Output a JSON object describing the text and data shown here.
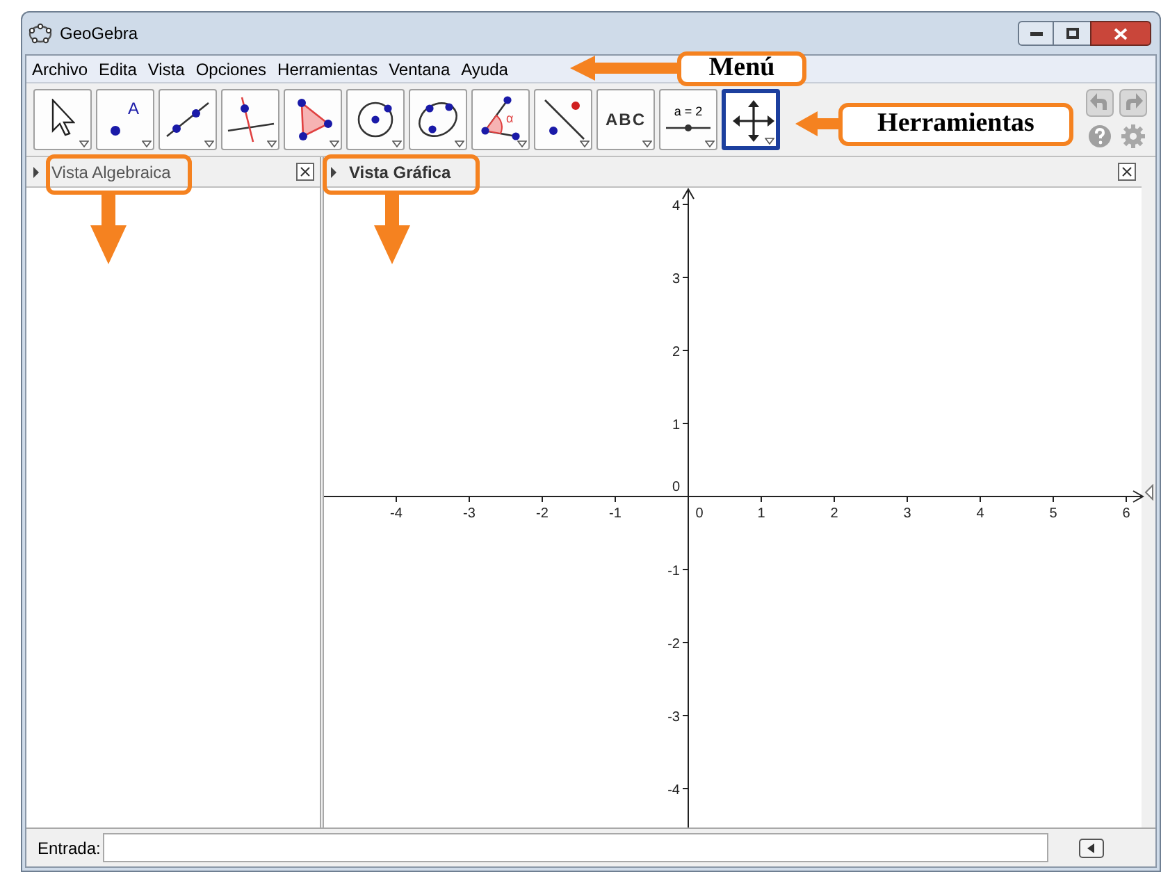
{
  "window": {
    "title": "GeoGebra"
  },
  "menu": [
    "Archivo",
    "Edita",
    "Vista",
    "Opciones",
    "Herramientas",
    "Ventana",
    "Ayuda"
  ],
  "tools": [
    {
      "kind": "move",
      "selected": false
    },
    {
      "kind": "point",
      "label": "A",
      "selected": false
    },
    {
      "kind": "line",
      "selected": false
    },
    {
      "kind": "perpendicular",
      "selected": false
    },
    {
      "kind": "polygon",
      "selected": false
    },
    {
      "kind": "circle",
      "selected": false
    },
    {
      "kind": "conic",
      "selected": false
    },
    {
      "kind": "angle",
      "label": "α",
      "selected": false
    },
    {
      "kind": "reflect",
      "selected": false
    },
    {
      "kind": "text",
      "label": "ABC",
      "selected": false
    },
    {
      "kind": "slider",
      "label": "a = 2",
      "selected": false
    },
    {
      "kind": "move-view",
      "selected": true
    }
  ],
  "views": [
    {
      "title": "Vista Algebraica",
      "selected": false
    },
    {
      "title": "Vista Gráfica",
      "selected": true
    }
  ],
  "graph": {
    "x_labels": [
      "-4",
      "-3",
      "-2",
      "-1",
      "0",
      "1",
      "2",
      "3",
      "4",
      "5",
      "6"
    ],
    "y_labels": [
      "4",
      "3",
      "2",
      "1",
      "0",
      "-1",
      "-2",
      "-3",
      "-4"
    ]
  },
  "input_bar": {
    "label": "Entrada:"
  },
  "annotations": [
    {
      "text": "Menú"
    },
    {
      "text": "Herramientas"
    }
  ]
}
